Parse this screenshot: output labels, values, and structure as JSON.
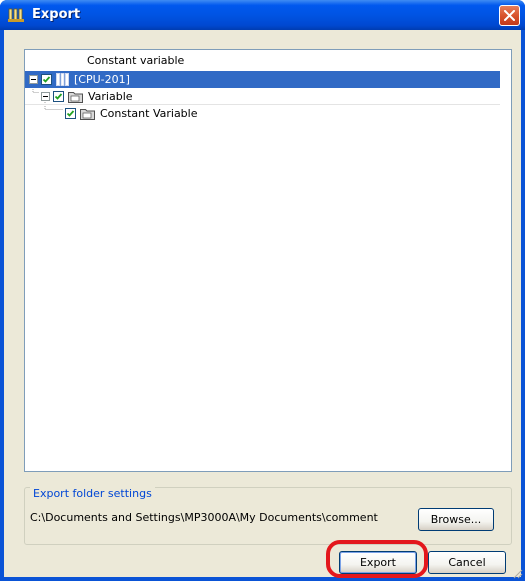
{
  "window": {
    "title": "Export"
  },
  "tree": {
    "column_header": "Constant variable",
    "items": [
      {
        "label": "[CPU-201]",
        "checked": true,
        "expanded": true,
        "icon": "cpu-icon",
        "selected": true
      },
      {
        "label": "Variable",
        "checked": true,
        "expanded": true,
        "icon": "folder-icon",
        "selected": false
      },
      {
        "label": "Constant Variable",
        "checked": true,
        "icon": "folder-icon",
        "selected": false
      }
    ]
  },
  "export_folder": {
    "group_label": "Export folder settings",
    "path": "C:\\Documents and Settings\\MP3000A\\My Documents\\comment",
    "browse_label": "Browse..."
  },
  "buttons": {
    "export_label": "Export",
    "cancel_label": "Cancel"
  },
  "colors": {
    "title_bar": "#0054e3",
    "selection": "#316ac5",
    "highlight_ring": "#e3171c",
    "group_label": "#0046d5",
    "dialog_face": "#ece9d8"
  }
}
